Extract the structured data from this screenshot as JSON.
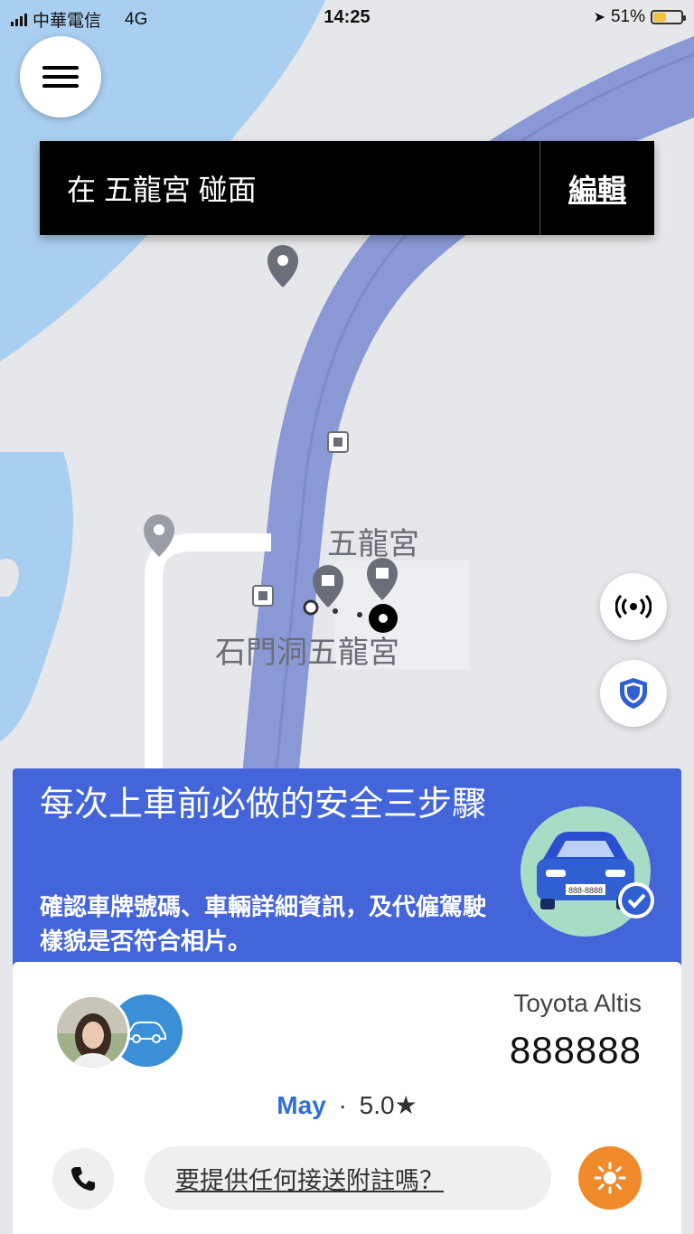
{
  "status_bar": {
    "carrier": "中華電信",
    "network": "4G",
    "time": "14:25",
    "battery": "51%",
    "battery_level": 0.51
  },
  "pickup": {
    "text": "在 五龍宮 碰面",
    "edit_label": "編輯"
  },
  "map": {
    "place_label": "五龍宮",
    "place_label_2": "石門洞五龍宮"
  },
  "safety_card": {
    "title": "每次上車前必做的安全三步驟",
    "description": "確認車牌號碼、車輛詳細資訊，及代僱駕駛樣貌是否符合相片。",
    "plate_on_art": "888-8888"
  },
  "driver": {
    "car_model": "Toyota Altis",
    "plate": "888888",
    "name": "May",
    "separator": "·",
    "rating": "5.0★",
    "note_placeholder": "要提供任何接送附註嗎？"
  },
  "colors": {
    "route": "#8a99d6",
    "water": "#a9cff0",
    "safety_bg": "#4465d9",
    "accent_orange": "#f08a2b"
  },
  "icons": {
    "menu": "hamburger-icon",
    "beacon": "beacon-icon",
    "shield": "shield-icon",
    "phone": "phone-icon",
    "sun": "sun-icon"
  }
}
